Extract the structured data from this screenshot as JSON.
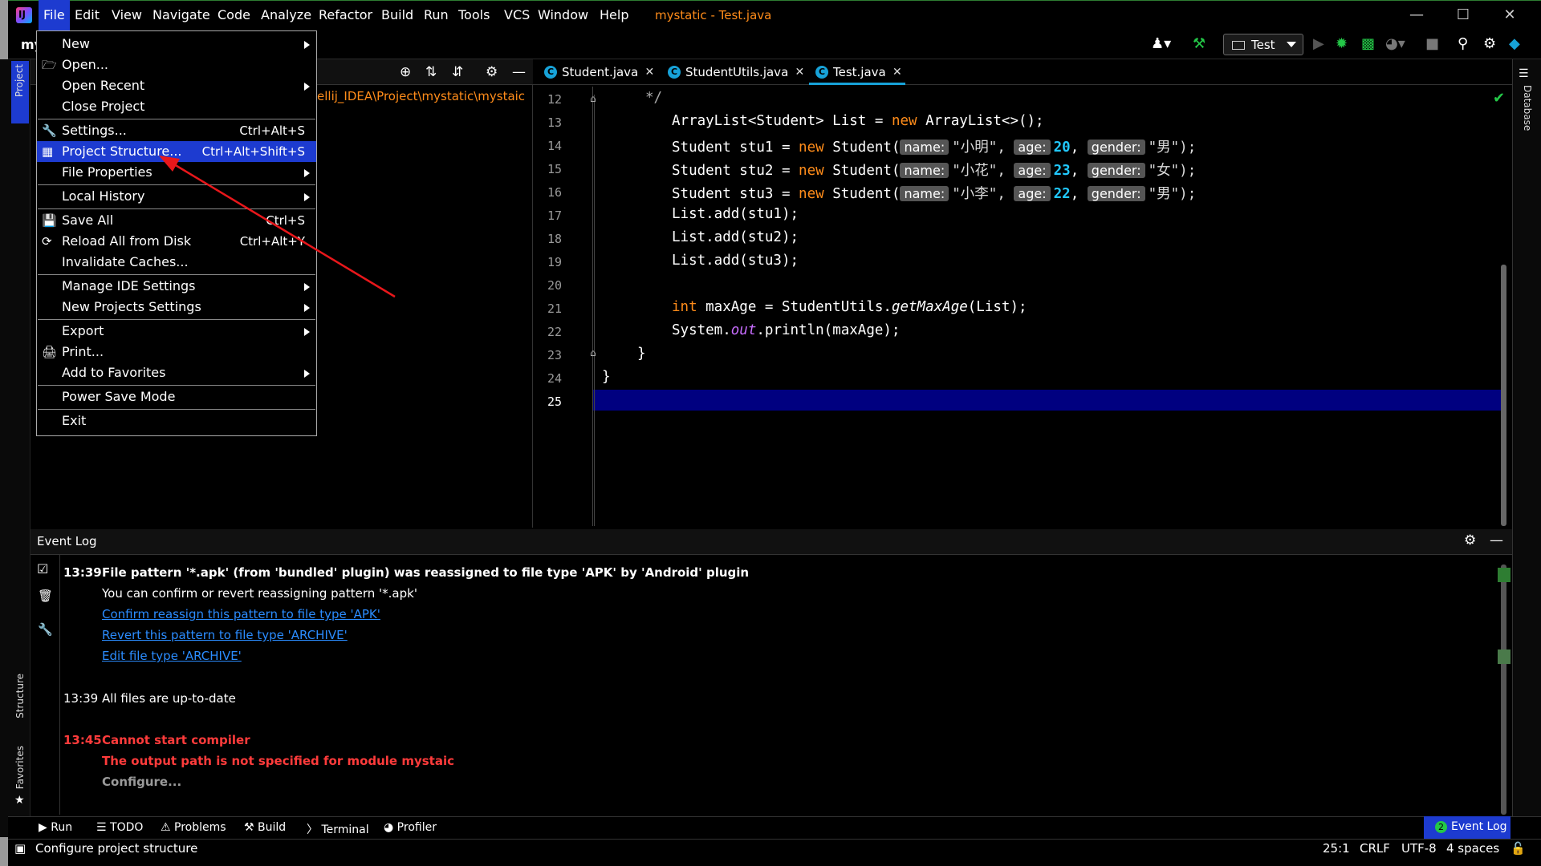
{
  "window": {
    "title": "mystatic - Test.java",
    "menus": [
      "File",
      "Edit",
      "View",
      "Navigate",
      "Code",
      "Analyze",
      "Refactor",
      "Build",
      "Run",
      "Tools",
      "VCS",
      "Window",
      "Help"
    ],
    "minimize": "—",
    "maximize": "☐",
    "close": "✕"
  },
  "toolbar": {
    "project_crumb": "my",
    "run_config": "Test"
  },
  "project_panel": {
    "tab_label": "Project",
    "path": "ellij_IDEA\\Project\\mystatic\\mystaic"
  },
  "file_menu": {
    "items": [
      {
        "label": "New",
        "shortcut": "",
        "submenu": true
      },
      {
        "label": "Open...",
        "shortcut": "",
        "submenu": false,
        "icon": "folder-icon"
      },
      {
        "label": "Open Recent",
        "shortcut": "",
        "submenu": true
      },
      {
        "label": "Close Project",
        "shortcut": "",
        "submenu": false
      },
      {
        "label": "Settings...",
        "shortcut": "Ctrl+Alt+S",
        "submenu": false,
        "icon": "wrench-icon"
      },
      {
        "label": "Project Structure...",
        "shortcut": "Ctrl+Alt+Shift+S",
        "submenu": false,
        "icon": "project-structure-icon",
        "selected": true
      },
      {
        "label": "File Properties",
        "shortcut": "",
        "submenu": true
      },
      {
        "label": "Local History",
        "shortcut": "",
        "submenu": true
      },
      {
        "label": "Save All",
        "shortcut": "Ctrl+S",
        "submenu": false,
        "icon": "save-icon"
      },
      {
        "label": "Reload All from Disk",
        "shortcut": "Ctrl+Alt+Y",
        "submenu": false,
        "icon": "reload-icon"
      },
      {
        "label": "Invalidate Caches...",
        "shortcut": "",
        "submenu": false
      },
      {
        "label": "Manage IDE Settings",
        "shortcut": "",
        "submenu": true
      },
      {
        "label": "New Projects Settings",
        "shortcut": "",
        "submenu": true
      },
      {
        "label": "Export",
        "shortcut": "",
        "submenu": true
      },
      {
        "label": "Print...",
        "shortcut": "",
        "submenu": false,
        "icon": "print-icon"
      },
      {
        "label": "Add to Favorites",
        "shortcut": "",
        "submenu": true
      },
      {
        "label": "Power Save Mode",
        "shortcut": "",
        "submenu": false
      },
      {
        "label": "Exit",
        "shortcut": "",
        "submenu": false
      }
    ]
  },
  "editor": {
    "tabs": [
      {
        "label": "Student.java",
        "active": false
      },
      {
        "label": "StudentUtils.java",
        "active": false
      },
      {
        "label": "Test.java",
        "active": true
      }
    ],
    "line_numbers": [
      "12",
      "13",
      "14",
      "15",
      "16",
      "17",
      "18",
      "19",
      "20",
      "21",
      "22",
      "23",
      "24",
      "25"
    ],
    "current_line": "25",
    "code": {
      "l12": "*/",
      "l13_a": "ArrayList<Student> List = ",
      "l13_kw": "new",
      "l13_b": " ArrayList<>();",
      "stu_decl_1": "Student stu1 = ",
      "stu_decl_2": "Student stu2 = ",
      "stu_decl_3": "Student stu3 = ",
      "new_kw": "new",
      "ctor": " Student(",
      "hint_name": "name:",
      "hint_age": "age:",
      "hint_gender": "gender:",
      "name_1": "\"小明\",",
      "name_2": "\"小花\",",
      "name_3": "\"小李\",",
      "age_1": "20",
      "age_2": "23",
      "age_3": "22",
      "comma": ",",
      "gender_1": "\"男\");",
      "gender_2": "\"女\");",
      "gender_3": "\"男\");",
      "l17": "List.add(stu1);",
      "l18": "List.add(stu2);",
      "l19": "List.add(stu3);",
      "l21_kw": "int",
      "l21_a": " maxAge = StudentUtils.",
      "l21_m": "getMaxAge",
      "l21_b": "(List);",
      "l22_a": "System.",
      "l22_f": "out",
      "l22_b": ".println(maxAge);",
      "l23": "}",
      "l24": "}"
    }
  },
  "event_log": {
    "title": "Event Log",
    "entries": {
      "e1_time": "13:39",
      "e1_title": "File pattern '*.apk' (from 'bundled' plugin) was reassigned to file type 'APK' by 'Android' plugin",
      "e1_body": "You can confirm or revert reassigning pattern '*.apk'",
      "e1_link1": "Confirm reassign this pattern to file type 'APK'",
      "e1_link2": "Revert this pattern to file type 'ARCHIVE'",
      "e1_link3": "Edit file type 'ARCHIVE'",
      "e2_time": "13:39",
      "e2_title": "All files are up-to-date",
      "e3_time": "13:45",
      "e3_title": "Cannot start compiler",
      "e3_body": "The output path is not specified for module mystaic",
      "e3_link": "Configure..."
    }
  },
  "tool_windows": {
    "bottom": [
      "Run",
      "TODO",
      "Problems",
      "Build",
      "Terminal",
      "Profiler"
    ],
    "event_log_button": "Event Log",
    "event_log_badge": "2",
    "right": "Database",
    "left_structure": "Structure",
    "left_favorites": "Favorites"
  },
  "status_bar": {
    "message": "Configure project structure",
    "position": "25:1",
    "line_ending": "CRLF",
    "encoding": "UTF-8",
    "indent": "4 spaces"
  },
  "colors": {
    "selection": "#1d3bd0",
    "keyword": "#ff8c1a",
    "number": "#21c8ff",
    "error": "#ff3b3b",
    "link": "#2b8cff",
    "title": "#ff8c1a"
  }
}
